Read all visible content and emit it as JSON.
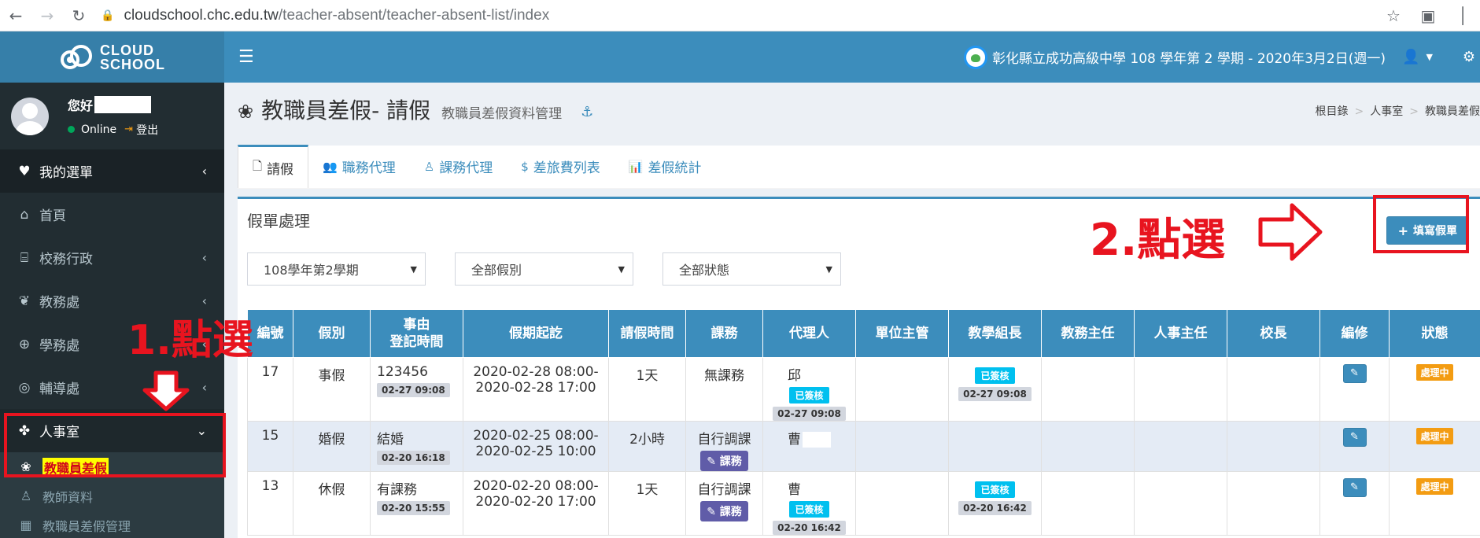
{
  "browser": {
    "url_host": "cloudschool.chc.edu.tw",
    "url_path": "/teacher-absent/teacher-absent-list/index"
  },
  "sidebar": {
    "logo_line1": "CLOUD",
    "logo_line2": "SCHOOL",
    "greeting": "您好",
    "status": "Online",
    "logout": "登出",
    "items": [
      {
        "label": "我的選單",
        "icon": "heart-icon"
      },
      {
        "label": "首頁",
        "icon": "home-icon"
      },
      {
        "label": "校務行政",
        "icon": "bank-icon"
      },
      {
        "label": "教務處",
        "icon": "leaf-icon"
      },
      {
        "label": "學務處",
        "icon": "compass-icon"
      },
      {
        "label": "輔導處",
        "icon": "lifebuoy-icon"
      },
      {
        "label": "人事室",
        "icon": "cubes-icon"
      }
    ],
    "subitems": [
      {
        "label": "教職員差假",
        "icon": "plant-icon"
      },
      {
        "label": "教師資料",
        "icon": "person-icon"
      },
      {
        "label": "教職員差假管理",
        "icon": "grid-icon"
      }
    ]
  },
  "topbar": {
    "school_info": "彰化縣立成功高級中學 108 學年第 2 學期 - 2020年3月2日(週一)"
  },
  "page": {
    "title": "教職員差假- 請假",
    "subtitle": "教職員差假資料管理",
    "breadcrumb": [
      "根目錄",
      "人事室",
      "教職員差假"
    ]
  },
  "tabs": [
    {
      "label": "請假",
      "icon": "file-icon"
    },
    {
      "label": "職務代理",
      "icon": "users-icon"
    },
    {
      "label": "課務代理",
      "icon": "user-icon"
    },
    {
      "label": "差旅費列表",
      "icon": "dollar-icon"
    },
    {
      "label": "差假統計",
      "icon": "bar-chart-icon"
    }
  ],
  "box": {
    "title": "假單處理",
    "add_button": "填寫假單",
    "filters": [
      "108學年第2學期",
      "全部假別",
      "全部狀態"
    ]
  },
  "table": {
    "headers": [
      "編號",
      "假別",
      "事由\n登記時間",
      "假期起訖",
      "請假時間",
      "課務",
      "代理人",
      "單位主管",
      "教學組長",
      "教務主任",
      "人事主任",
      "校長",
      "編修",
      "狀態"
    ],
    "rows": [
      {
        "id": "17",
        "type": "事假",
        "reason": "123456",
        "reg_time": "02-27 09:08",
        "period_start": "2020-02-28 08:00-",
        "period_end": "2020-02-28 17:00",
        "duration": "1天",
        "course": "無課務",
        "course_btn": "",
        "agent": "邱",
        "agent_badge": "已簽核",
        "agent_time": "02-27 09:08",
        "teach_badge": "已簽核",
        "teach_time": "02-27 09:08",
        "status": "處理中"
      },
      {
        "id": "15",
        "type": "婚假",
        "reason": "結婚",
        "reg_time": "02-20 16:18",
        "period_start": "2020-02-25 08:00-",
        "period_end": "2020-02-25 10:00",
        "duration": "2小時",
        "course": "自行調課",
        "course_btn": "課務",
        "agent": "曹",
        "agent_badge": "",
        "agent_time": "",
        "teach_badge": "",
        "teach_time": "",
        "status": "處理中"
      },
      {
        "id": "13",
        "type": "休假",
        "reason": "有課務",
        "reg_time": "02-20 15:55",
        "period_start": "2020-02-20 08:00-",
        "period_end": "2020-02-20 17:00",
        "duration": "1天",
        "course": "自行調課",
        "course_btn": "課務",
        "agent": "曹",
        "agent_badge": "已簽核",
        "agent_time": "02-20 16:42",
        "teach_badge": "已簽核",
        "teach_time": "02-20 16:42",
        "status": "處理中"
      }
    ]
  },
  "annotations": {
    "step1": "1.點選",
    "step2": "2.點選"
  }
}
